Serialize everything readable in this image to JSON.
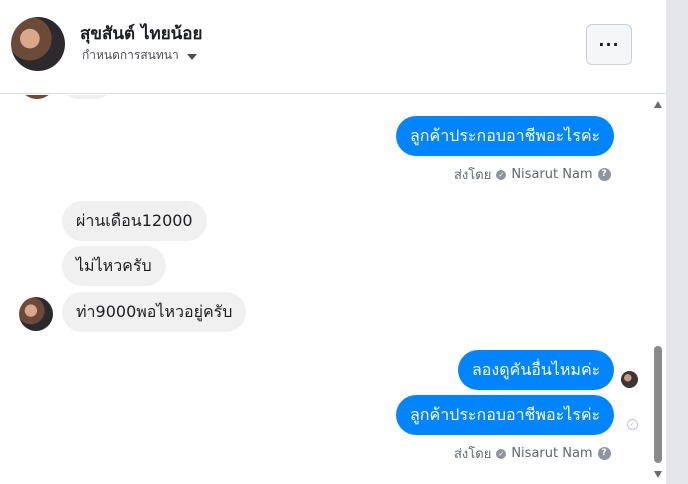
{
  "header": {
    "contact_name": "สุขสันต์ ไทยน้อย",
    "conversation_settings": "กำหนดการสนทนา",
    "more_button": "···"
  },
  "messages": [
    {
      "direction": "out",
      "text": "ลูกค้าประกอบอาชีพอะไรค่ะ"
    },
    {
      "direction": "in",
      "text": "ผ่านเดือน12000"
    },
    {
      "direction": "in",
      "text": "ไม่ไหวครับ"
    },
    {
      "direction": "in",
      "text": "ท่า9000พอไหวอยู่ครับ"
    },
    {
      "direction": "out",
      "text": "ลองดูคันอื่นไหมค่ะ"
    },
    {
      "direction": "out",
      "text": "ลูกค้าประกอบอาชีพอะไรค่ะ"
    }
  ],
  "sent_by": {
    "prefix": "ส่งโดย",
    "agent_name": "Nisarut Nam",
    "help_icon": "?"
  },
  "colors": {
    "outgoing_bubble": "#0084ff",
    "incoming_bubble": "#f1f0f0"
  },
  "icons": [
    "avatar",
    "chevron-down-icon",
    "more-icon",
    "verified-check-icon",
    "help-icon",
    "seen-avatar-icon",
    "sent-check-icon"
  ]
}
